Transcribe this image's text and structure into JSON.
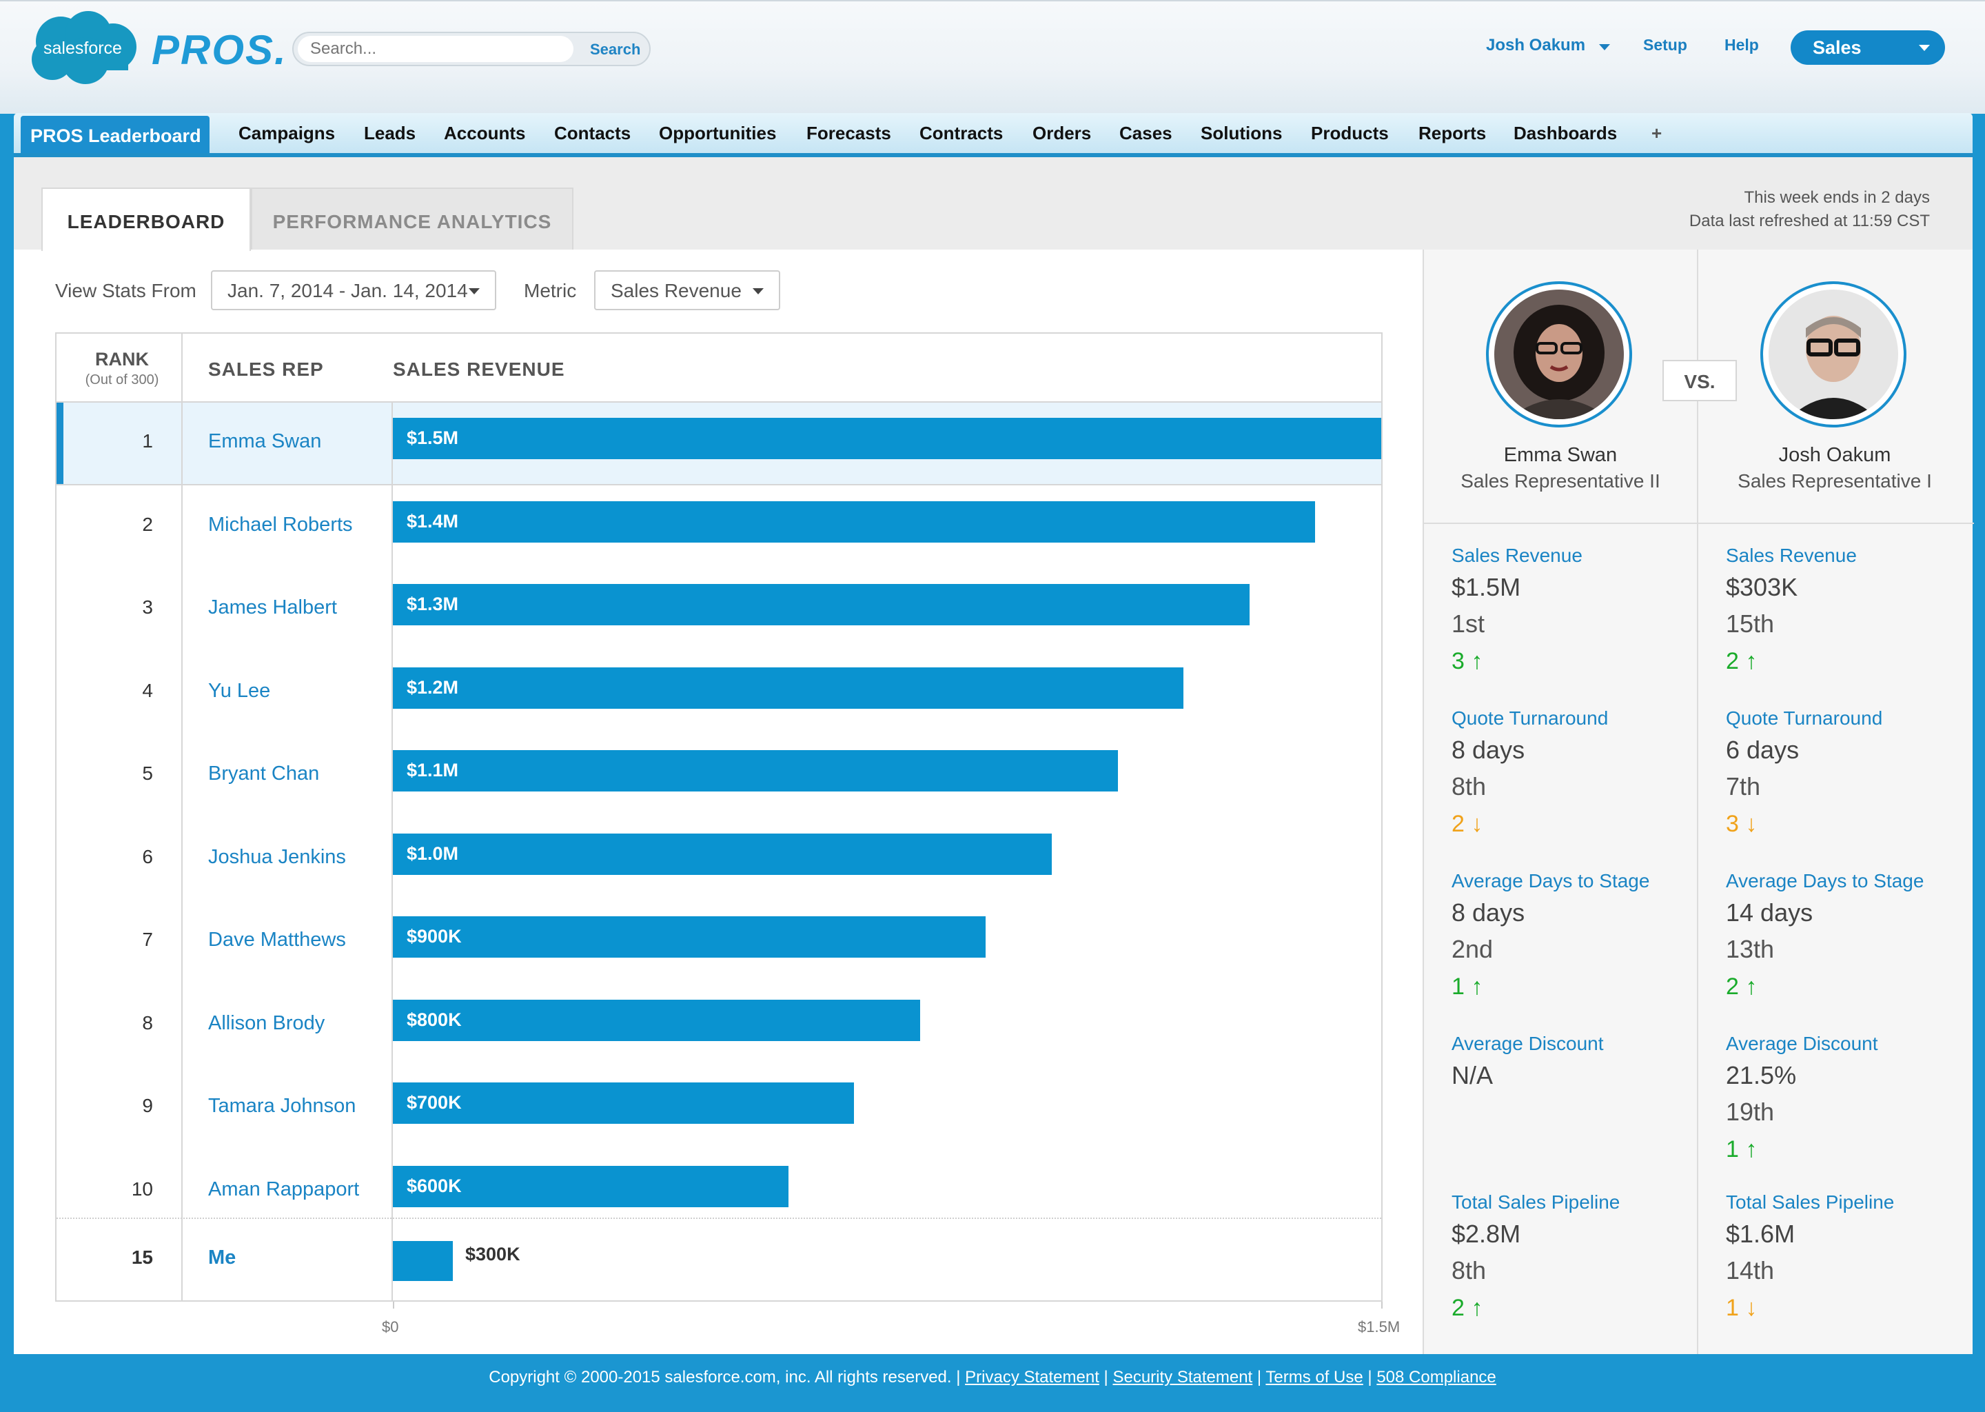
{
  "header": {
    "brand": "salesforce",
    "app_logo": "PROS.",
    "search_placeholder": "Search...",
    "search_button": "Search",
    "user_name": "Josh Oakum",
    "setup": "Setup",
    "help": "Help",
    "app_switcher": "Sales"
  },
  "nav": {
    "active": "PROS Leaderboard",
    "tabs": [
      "Campaigns",
      "Leads",
      "Accounts",
      "Contacts",
      "Opportunities",
      "Forecasts",
      "Contracts",
      "Orders",
      "Cases",
      "Solutions",
      "Products",
      "Reports",
      "Dashboards"
    ],
    "plus": "+"
  },
  "subtabs": {
    "leaderboard": "LEADERBOARD",
    "analytics": "PERFORMANCE ANALYTICS"
  },
  "info": {
    "week": "This week ends in 2 days",
    "refresh": "Data last refreshed at 11:59 CST"
  },
  "filters": {
    "view_label": "View Stats From",
    "date_value": "Jan. 7, 2014 - Jan. 14, 2014",
    "metric_label": "Metric",
    "metric_value": "Sales Revenue"
  },
  "table": {
    "rank_header": "RANK",
    "rank_sub": "(Out of 300)",
    "rep_header": "SALES REP",
    "rev_header": "SALES REVENUE",
    "axis_min": "$0",
    "axis_max": "$1.5M"
  },
  "chart_data": {
    "type": "bar",
    "orientation": "horizontal",
    "xlim": [
      0,
      1.5
    ],
    "unit": "$M",
    "rows": [
      {
        "rank": "1",
        "name": "Emma Swan",
        "label": "$1.5M",
        "value": 1.5
      },
      {
        "rank": "2",
        "name": "Michael Roberts",
        "label": "$1.4M",
        "value": 1.4
      },
      {
        "rank": "3",
        "name": "James Halbert",
        "label": "$1.3M",
        "value": 1.3
      },
      {
        "rank": "4",
        "name": "Yu Lee",
        "label": "$1.2M",
        "value": 1.2
      },
      {
        "rank": "5",
        "name": "Bryant Chan",
        "label": "$1.1M",
        "value": 1.1
      },
      {
        "rank": "6",
        "name": "Joshua Jenkins",
        "label": "$1.0M",
        "value": 1.0
      },
      {
        "rank": "7",
        "name": "Dave Matthews",
        "label": "$900K",
        "value": 0.9
      },
      {
        "rank": "8",
        "name": "Allison Brody",
        "label": "$800K",
        "value": 0.8
      },
      {
        "rank": "9",
        "name": "Tamara Johnson",
        "label": "$700K",
        "value": 0.7
      },
      {
        "rank": "10",
        "name": "Aman Rappaport",
        "label": "$600K",
        "value": 0.6
      }
    ],
    "me": {
      "rank": "15",
      "name": "Me",
      "label": "$300K",
      "value": 0.3
    }
  },
  "compare": {
    "vs": "VS.",
    "left": {
      "name": "Emma Swan",
      "role": "Sales Representative II",
      "stats": [
        {
          "title": "Sales Revenue",
          "value": "$1.5M",
          "rank": "1st",
          "change": "3",
          "dir": "up"
        },
        {
          "title": "Quote Turnaround",
          "value": "8 days",
          "rank": "8th",
          "change": "2",
          "dir": "down"
        },
        {
          "title": "Average Days to Stage",
          "value": "8 days",
          "rank": "2nd",
          "change": "1",
          "dir": "up"
        },
        {
          "title": "Average Discount",
          "value": "N/A",
          "rank": "",
          "change": "",
          "dir": ""
        },
        {
          "title": "Total Sales Pipeline",
          "value": "$2.8M",
          "rank": "8th",
          "change": "2",
          "dir": "up"
        }
      ]
    },
    "right": {
      "name": "Josh Oakum",
      "role": "Sales Representative I",
      "stats": [
        {
          "title": "Sales Revenue",
          "value": "$303K",
          "rank": "15th",
          "change": "2",
          "dir": "up"
        },
        {
          "title": "Quote Turnaround",
          "value": "6 days",
          "rank": "7th",
          "change": "3",
          "dir": "down"
        },
        {
          "title": "Average Days to Stage",
          "value": "14 days",
          "rank": "13th",
          "change": "2",
          "dir": "up"
        },
        {
          "title": "Average Discount",
          "value": "21.5%",
          "rank": "19th",
          "change": "1",
          "dir": "up"
        },
        {
          "title": "Total Sales Pipeline",
          "value": "$1.6M",
          "rank": "14th",
          "change": "1",
          "dir": "down"
        }
      ]
    }
  },
  "footer": {
    "copyright": "Copyright © 2000-2015 salesforce.com, inc. All rights reserved. |",
    "links": [
      "Privacy Statement",
      "Security Statement",
      "Terms of Use",
      "508 Compliance"
    ]
  }
}
